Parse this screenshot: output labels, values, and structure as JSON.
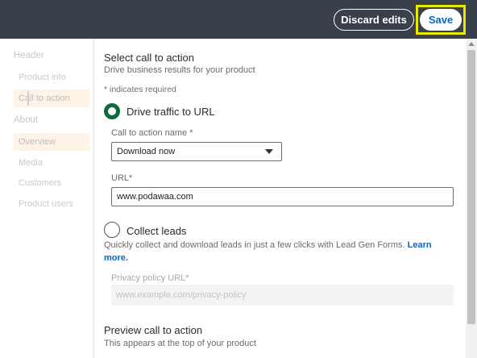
{
  "topbar": {
    "discard_label": "Discard edits",
    "save_label": "Save"
  },
  "sidebar": {
    "sections": [
      {
        "label": "Header"
      },
      {
        "label": "About"
      }
    ],
    "items": [
      {
        "label": "Product info"
      },
      {
        "label": "Call to action",
        "selected": true
      },
      {
        "label": "Overview"
      },
      {
        "label": "Media"
      },
      {
        "label": "Customers"
      },
      {
        "label": "Product users"
      }
    ]
  },
  "main": {
    "title": "Select call to action",
    "subtitle": "Drive business results for your product",
    "required_note": "* indicates required",
    "option_url": {
      "label": "Drive traffic to URL",
      "selected": true
    },
    "cta_name": {
      "label": "Call to action name *",
      "value": "Download now"
    },
    "url": {
      "label": "URL*",
      "value": "www.podawaa.com"
    },
    "option_leads": {
      "label": "Collect leads",
      "selected": false
    },
    "leads_description": "Quickly collect and download leads in just a few clicks with Lead Gen Forms.",
    "learn_more": "Learn more.",
    "privacy": {
      "label": "Privacy policy URL*",
      "placeholder": "www.example.com/privacy-policy"
    },
    "preview": {
      "title": "Preview call to action",
      "subtitle": "This appears at the top of your product"
    }
  },
  "colors": {
    "topbar": "#3a4049",
    "accent_green": "#0e6b3e",
    "link_blue": "#0a66c2",
    "highlight_yellow": "#e8e800"
  }
}
